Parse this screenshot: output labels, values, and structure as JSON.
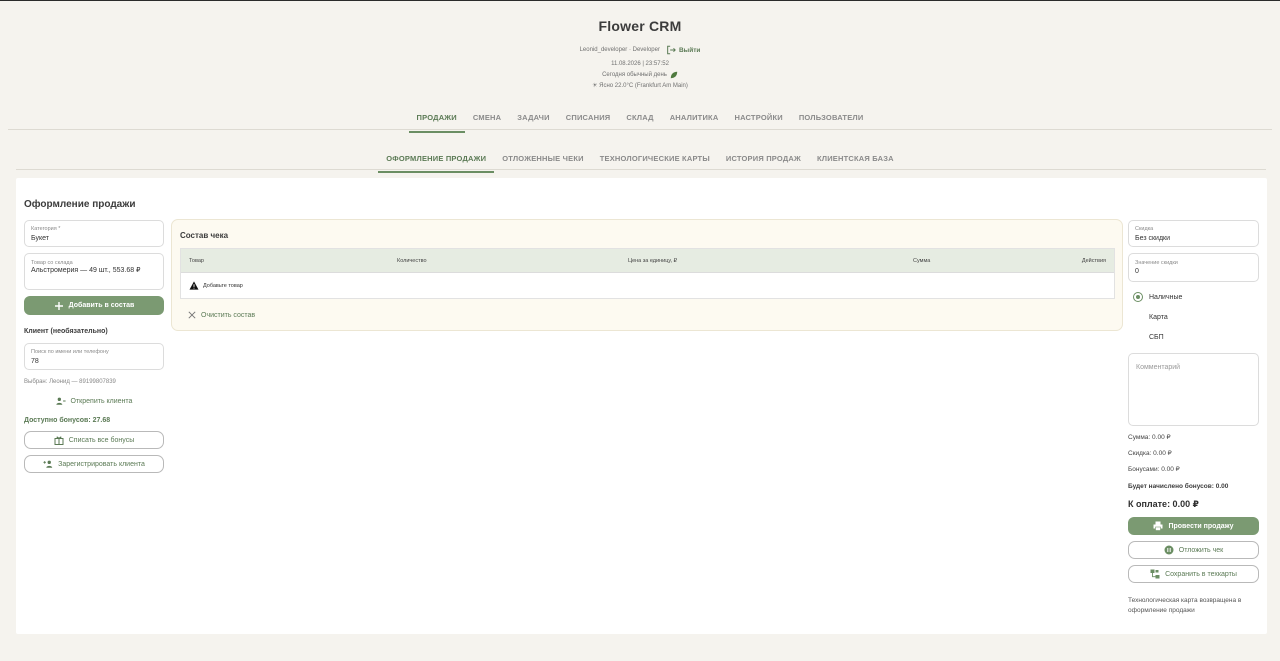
{
  "header": {
    "app_title": "Flower CRM",
    "user": "Leonid_developer · Developer",
    "logout": "Выйти",
    "datetime": "11.08.2026 | 23:57:52",
    "day_text": "Сегодня обычный день",
    "weather": "☀ Ясно 22.0°C (Frankfurt Am Main)"
  },
  "main_tabs": [
    "ПРОДАЖИ",
    "СМЕНА",
    "ЗАДАЧИ",
    "СПИСАНИЯ",
    "СКЛАД",
    "АНАЛИТИКА",
    "НАСТРОЙКИ",
    "ПОЛЬЗОВАТЕЛИ"
  ],
  "sub_tabs": [
    "ОФОРМЛЕНИЕ ПРОДАЖИ",
    "ОТЛОЖЕННЫЕ ЧЕКИ",
    "ТЕХНОЛОГИЧЕСКИЕ КАРТЫ",
    "ИСТОРИЯ ПРОДАЖ",
    "КЛИЕНТСКАЯ БАЗА"
  ],
  "page_title": "Оформление продажи",
  "left": {
    "category_label": "Категория *",
    "category_value": "Букет",
    "stock_label": "Товар со склада",
    "stock_value": "Альстромерия — 49 шт., 553.68 ₽",
    "add_button": "Добавить в состав",
    "client_heading": "Клиент (необязательно)",
    "search_label": "Поиск по имени или телефону",
    "search_value": "78",
    "selected_client": "Выбран: Леонид — 89199807839",
    "unpin_button": "Открепить клиента",
    "bonuses_available": "Доступно бонусов: 27.68",
    "spend_bonuses_button": "Списать все бонусы",
    "register_button": "Зарегистрировать клиента"
  },
  "receipt": {
    "title": "Состав чека",
    "columns": [
      "Товар",
      "Количество",
      "Цена за единицу, ₽",
      "Сумма",
      "Действия"
    ],
    "empty_text": "Добавьте товар",
    "clear_button": "Очистить состав"
  },
  "right": {
    "discount_label": "Скидка",
    "discount_value": "Без скидки",
    "discount_amount_label": "Значение скидки",
    "discount_amount_value": "0",
    "payment_methods": [
      "Наличные",
      "Карта",
      "СБП"
    ],
    "selected_payment": "Наличные",
    "comment_placeholder": "Комментарий",
    "sum": "Сумма: 0.00 ₽",
    "discount": "Скидка: 0.00 ₽",
    "bonuses": "Бонусами: 0.00 ₽",
    "accrued": "Будет начислено бонусов: 0.00",
    "to_pay": "К оплате: 0.00 ₽",
    "checkout_button": "Провести продажу",
    "postpone_button": "Отложить чек",
    "save_card_button": "Сохранить в техкарты",
    "note": "Технологическая карта возвращена в оформление продажи"
  },
  "colors": {
    "accent": "#6b8e63",
    "button_green": "#7b9a72",
    "background": "#f5f3ee"
  }
}
